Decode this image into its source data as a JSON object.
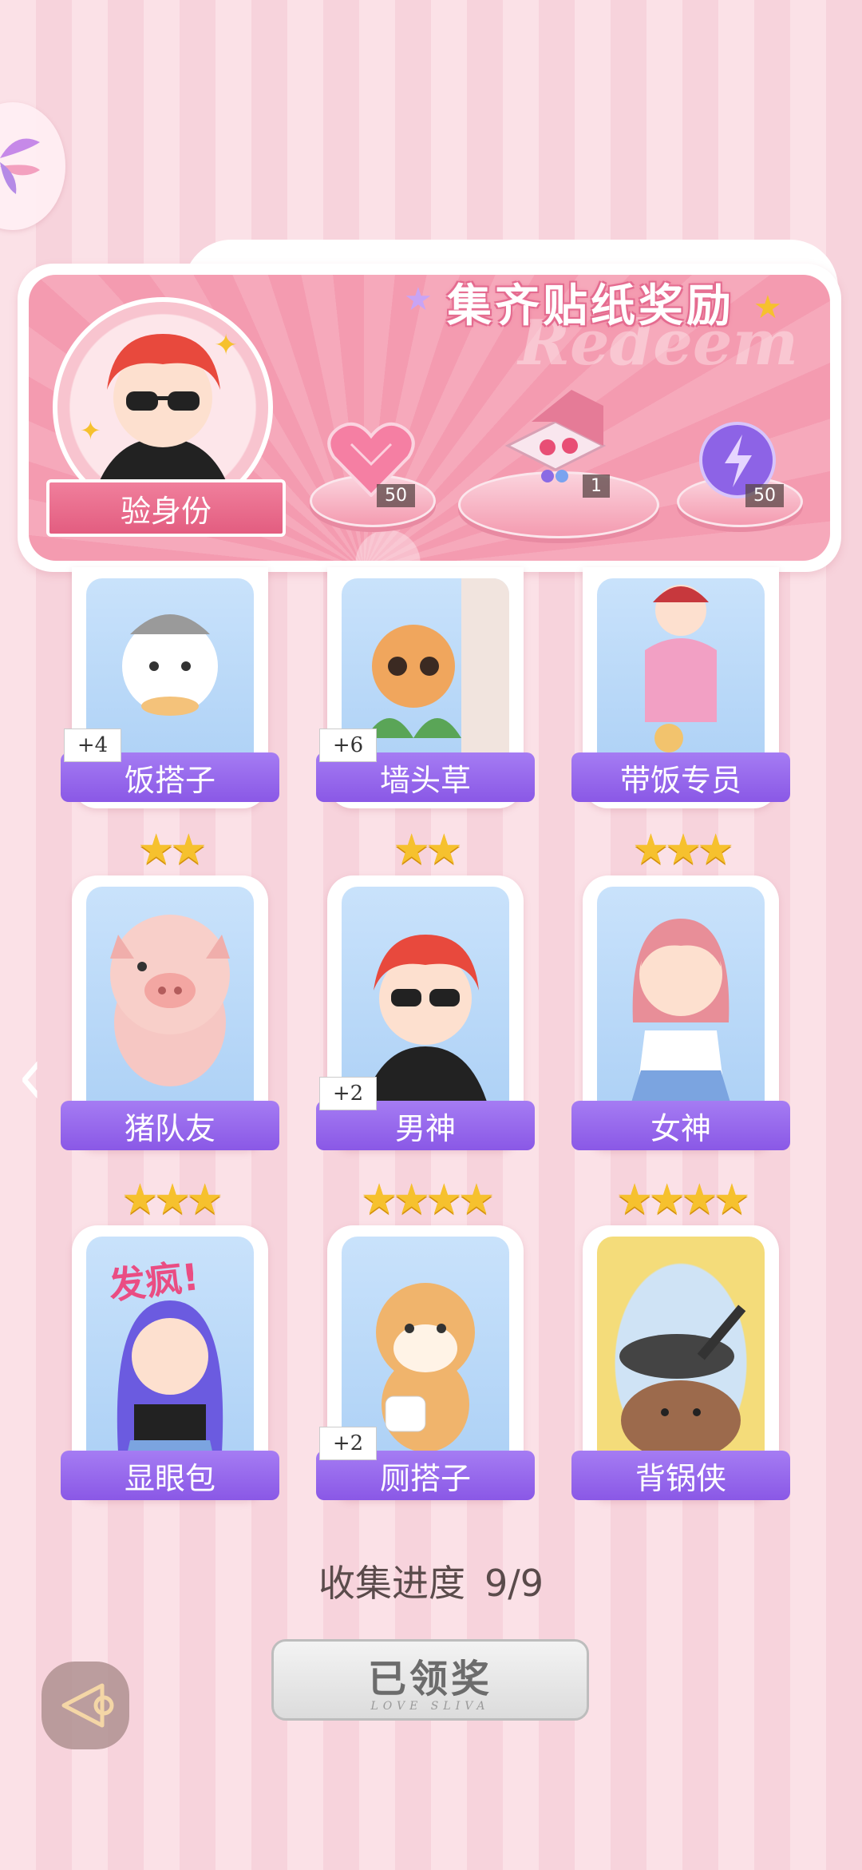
{
  "banner": {
    "title": "集齐贴纸奖励",
    "watermark": "Redeem",
    "verify_button": "验身份",
    "rewards": [
      {
        "icon": "heart-gem-icon",
        "count": "50"
      },
      {
        "icon": "gift-box-icon",
        "count": "1"
      },
      {
        "icon": "energy-orb-icon",
        "count": "50"
      }
    ]
  },
  "cards": [
    {
      "label": "饭搭子",
      "plus": "+4",
      "stars": 0,
      "art": "cat-with-cake"
    },
    {
      "label": "墙头草",
      "plus": "+6",
      "stars": 0,
      "art": "cat-peeking"
    },
    {
      "label": "带饭专员",
      "plus": "",
      "stars": 0,
      "art": "girl-with-lunch"
    },
    {
      "label": "猪队友",
      "plus": "",
      "stars": 2,
      "art": "pig"
    },
    {
      "label": "男神",
      "plus": "+2",
      "stars": 2,
      "art": "boy-sunglasses"
    },
    {
      "label": "女神",
      "plus": "",
      "stars": 3,
      "art": "girl-uniform"
    },
    {
      "label": "显眼包",
      "plus": "",
      "stars": 3,
      "art": "girl-crazy",
      "caption": "发疯!"
    },
    {
      "label": "厕搭子",
      "plus": "+2",
      "stars": 4,
      "art": "shiba-toilet-paper"
    },
    {
      "label": "背锅侠",
      "plus": "",
      "stars": 4,
      "art": "capybara-pan"
    }
  ],
  "progress": {
    "label": "收集进度",
    "value": "9/9"
  },
  "claim_button": {
    "label": "已领奖",
    "sub": "LOVE SLIVA"
  },
  "colors": {
    "accent": "#8a58e6",
    "banner_pink": "#f49bb0",
    "star": "#f6c12e"
  }
}
